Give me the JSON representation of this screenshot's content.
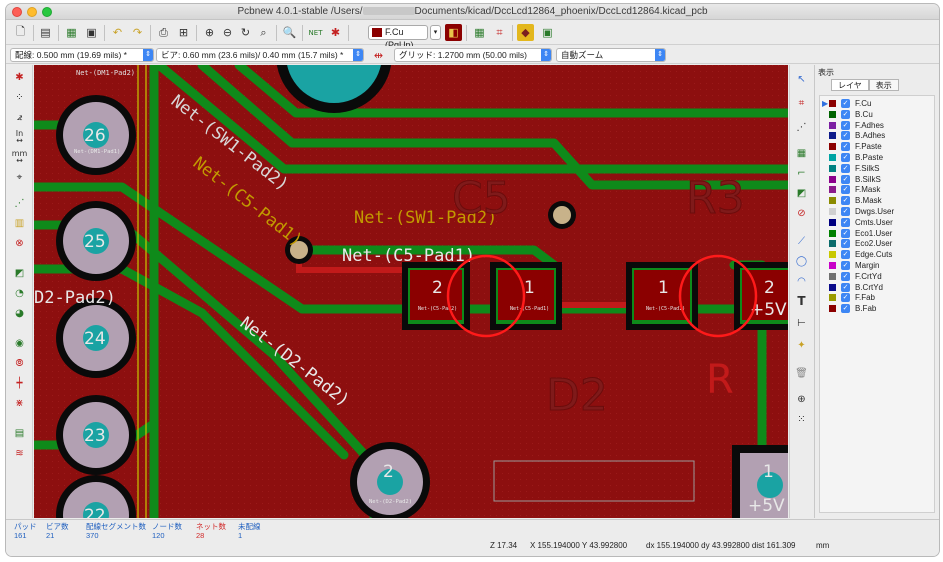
{
  "window": {
    "title_prefix": "Pcbnew 4.0.1-stable /Users/",
    "title_suffix": "Documents/kicad/DccLcd12864_phoenix/DccLcd12864.kicad_pcb"
  },
  "toolbar": {
    "active_layer": "F.Cu (PgUp)",
    "active_layer_color": "#8b0000"
  },
  "toolbar2": {
    "track_width": "配線: 0.500 mm (19.69 mils) *",
    "via_size": "ビア: 0.60 mm (23.6 mils)/ 0.40 mm (15.7 mils) *",
    "grid": "グリッド: 1.2700 mm (50.00 mils)",
    "zoom": "自動ズーム"
  },
  "left_toolbar": {
    "units_in": "In",
    "units_mm": "mm"
  },
  "pcb": {
    "pads": [
      {
        "label": "26",
        "net": "Net-(DM1-Pad1)"
      },
      {
        "label": "25",
        "net": ""
      },
      {
        "label": "24",
        "net": ""
      },
      {
        "label": "23",
        "net": ""
      },
      {
        "label": "22",
        "net": ""
      }
    ],
    "top_pad_net": "Net-(DM1-Pad2)",
    "smd_c5": [
      {
        "num": "2",
        "net": "Net-(C5-Pad2)"
      },
      {
        "num": "1",
        "net": "Net-(C5-Pad1)"
      }
    ],
    "smd_r3": [
      {
        "num": "1",
        "net": "Net-(C5-Pad1)"
      },
      {
        "num": "2",
        "net": "+5V"
      }
    ],
    "d2_pad": {
      "num": "2",
      "net": "Net-(D2-Pad2)"
    },
    "bottom_right_pad": {
      "num": "1",
      "net": "+5V"
    },
    "net_labels": {
      "sw1_diag": "Net-(SW1-Pad2)",
      "c5_diag": "Net-(C5-Pad1)",
      "sw1_horiz": "Net-(SW1-Pad2)",
      "c5_horiz": "Net-(C5-Pad1)",
      "d2_left": "D2-Pad2)",
      "d2_diag": "Net-(D2-Pad2)"
    },
    "silk": {
      "c5": "C5",
      "r3": "R3",
      "d2": "D2",
      "r": "R"
    }
  },
  "panel": {
    "title": "表示",
    "tabs": [
      "レイヤ",
      "表示"
    ],
    "layers": [
      {
        "name": "F.Cu",
        "color": "#8b0000",
        "active": true
      },
      {
        "name": "B.Cu",
        "color": "#006400",
        "active": false
      },
      {
        "name": "F.Adhes",
        "color": "#7b1fa2",
        "active": false
      },
      {
        "name": "B.Adhes",
        "color": "#0d1a8a",
        "active": false
      },
      {
        "name": "F.Paste",
        "color": "#8b0000",
        "active": false
      },
      {
        "name": "B.Paste",
        "color": "#00a5a5",
        "active": false
      },
      {
        "name": "F.SilkS",
        "color": "#008080",
        "active": false
      },
      {
        "name": "B.SilkS",
        "color": "#8b008b",
        "active": false
      },
      {
        "name": "F.Mask",
        "color": "#8b1a8b",
        "active": false
      },
      {
        "name": "B.Mask",
        "color": "#8b8b00",
        "active": false
      },
      {
        "name": "Dwgs.User",
        "color": "#d0d0d0",
        "active": false
      },
      {
        "name": "Cmts.User",
        "color": "#000080",
        "active": false
      },
      {
        "name": "Eco1.User",
        "color": "#008000",
        "active": false
      },
      {
        "name": "Eco2.User",
        "color": "#0b6b6b",
        "active": false
      },
      {
        "name": "Edge.Cuts",
        "color": "#c8c800",
        "active": false
      },
      {
        "name": "Margin",
        "color": "#c800c8",
        "active": false
      },
      {
        "name": "F.CrtYd",
        "color": "#707070",
        "active": false
      },
      {
        "name": "B.CrtYd",
        "color": "#0a0a8a",
        "active": false
      },
      {
        "name": "F.Fab",
        "color": "#9a9a00",
        "active": false
      },
      {
        "name": "B.Fab",
        "color": "#8b0000",
        "active": false
      }
    ]
  },
  "status": {
    "stats": [
      {
        "label": "パッド",
        "value": "161",
        "red": false
      },
      {
        "label": "ビア数",
        "value": "21",
        "red": false
      },
      {
        "label": "配線セグメント数",
        "value": "370",
        "red": false
      },
      {
        "label": "ノード数",
        "value": "120",
        "red": false
      },
      {
        "label": "ネット数",
        "value": "28",
        "red": true
      },
      {
        "label": "未配線",
        "value": "1",
        "red": false
      }
    ],
    "zoom": "Z 17.34",
    "xy": "X 155.194000  Y 43.992800",
    "dxy": "dx 155.194000  dy 43.992800  dist 161.309",
    "units": "mm"
  }
}
